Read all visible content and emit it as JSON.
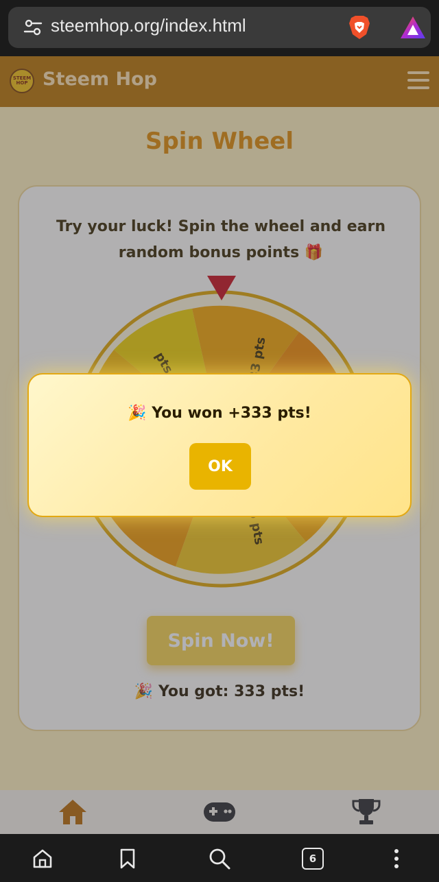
{
  "browser": {
    "url": "steemhop.org/index.html",
    "icons": [
      "tune-icon",
      "brave-shield-icon",
      "brave-rewards-icon"
    ]
  },
  "app": {
    "brand": "Steem Hop",
    "logo_text": "STEEM HOP",
    "menu_icon": "hamburger-menu-icon"
  },
  "page": {
    "title": "Spin Wheel",
    "description": "Try your luck! Spin the wheel and earn random bonus points 🎁",
    "wheel_labels": [
      "333 pts",
      "5 pts",
      "pts"
    ],
    "spin_button": "Spin Now!",
    "result": "🎉 You got: 333 pts!"
  },
  "modal": {
    "message": "🎉 You won +333 pts!",
    "ok_button": "OK"
  },
  "bottom_nav": {
    "items": [
      "home-icon",
      "gamepad-icon",
      "trophy-icon"
    ]
  },
  "system_nav": {
    "tab_count": "6",
    "items": [
      "home-icon",
      "bookmark-icon",
      "search-icon",
      "tabs-icon",
      "more-icon"
    ]
  },
  "colors": {
    "header": "#b87400",
    "accent": "#e08a00",
    "wheel_gold": "#f2c418",
    "wheel_orange": "#f29a00"
  }
}
